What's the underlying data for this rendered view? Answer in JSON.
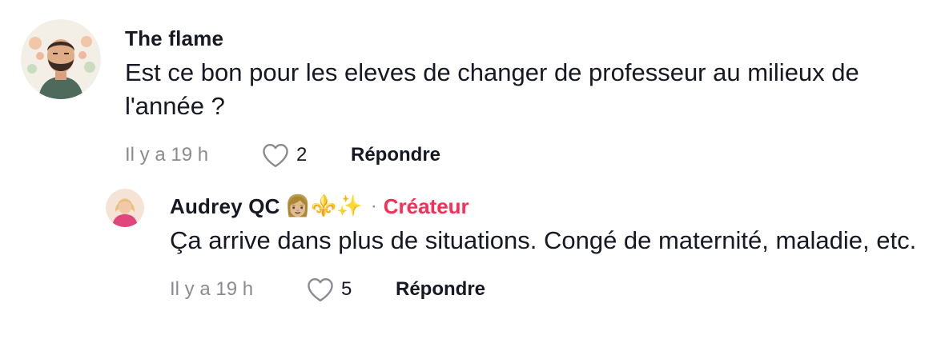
{
  "comments": [
    {
      "username": "The flame",
      "text": "Est ce bon pour les eleves de changer de professeur au milieux de l'année ?",
      "time": "Il y a 19 h",
      "likes": "2",
      "reply_label": "Répondre"
    }
  ],
  "reply": {
    "username": "Audrey QC",
    "emojis": "👩🏼⚜️✨",
    "separator": "·",
    "badge": "Créateur",
    "text": "Ça arrive dans plus de situations. Congé de maternité, maladie, etc.",
    "time": "Il y a 19 h",
    "likes": "5",
    "reply_label": "Répondre"
  },
  "colors": {
    "creator_badge": "#fe2c55",
    "muted_text": "#8a8b91",
    "primary_text": "#161823"
  },
  "icons": {
    "like": "heart-outline-icon"
  }
}
